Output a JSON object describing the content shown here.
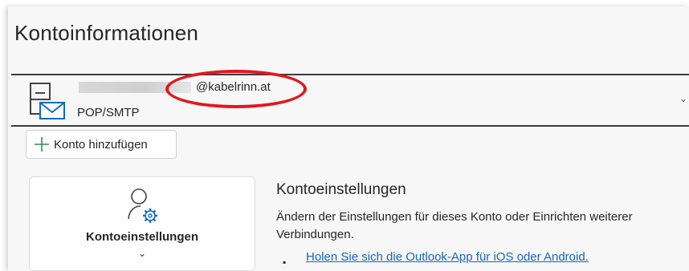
{
  "header": {
    "title": "Kontoinformationen"
  },
  "account": {
    "email": "@kabelrinn.at",
    "type": "POP/SMTP",
    "icon": "mailbox-icon"
  },
  "add_account": {
    "label": "Konto hinzufügen",
    "icon": "plus-icon"
  },
  "settings_card": {
    "label": "Kontoeinstellungen",
    "icon": "user-gear-icon"
  },
  "settings_section": {
    "heading": "Kontoeinstellungen",
    "description": "Ändern der Einstellungen für dieses Konto oder Einrichten weiterer Verbindungen.",
    "bullet": "▪",
    "link": "Holen Sie sich die Outlook-App für iOS oder Android."
  },
  "colors": {
    "accent": "#0f6cbd",
    "highlight": "#e5161d",
    "link": "#1565c0"
  }
}
